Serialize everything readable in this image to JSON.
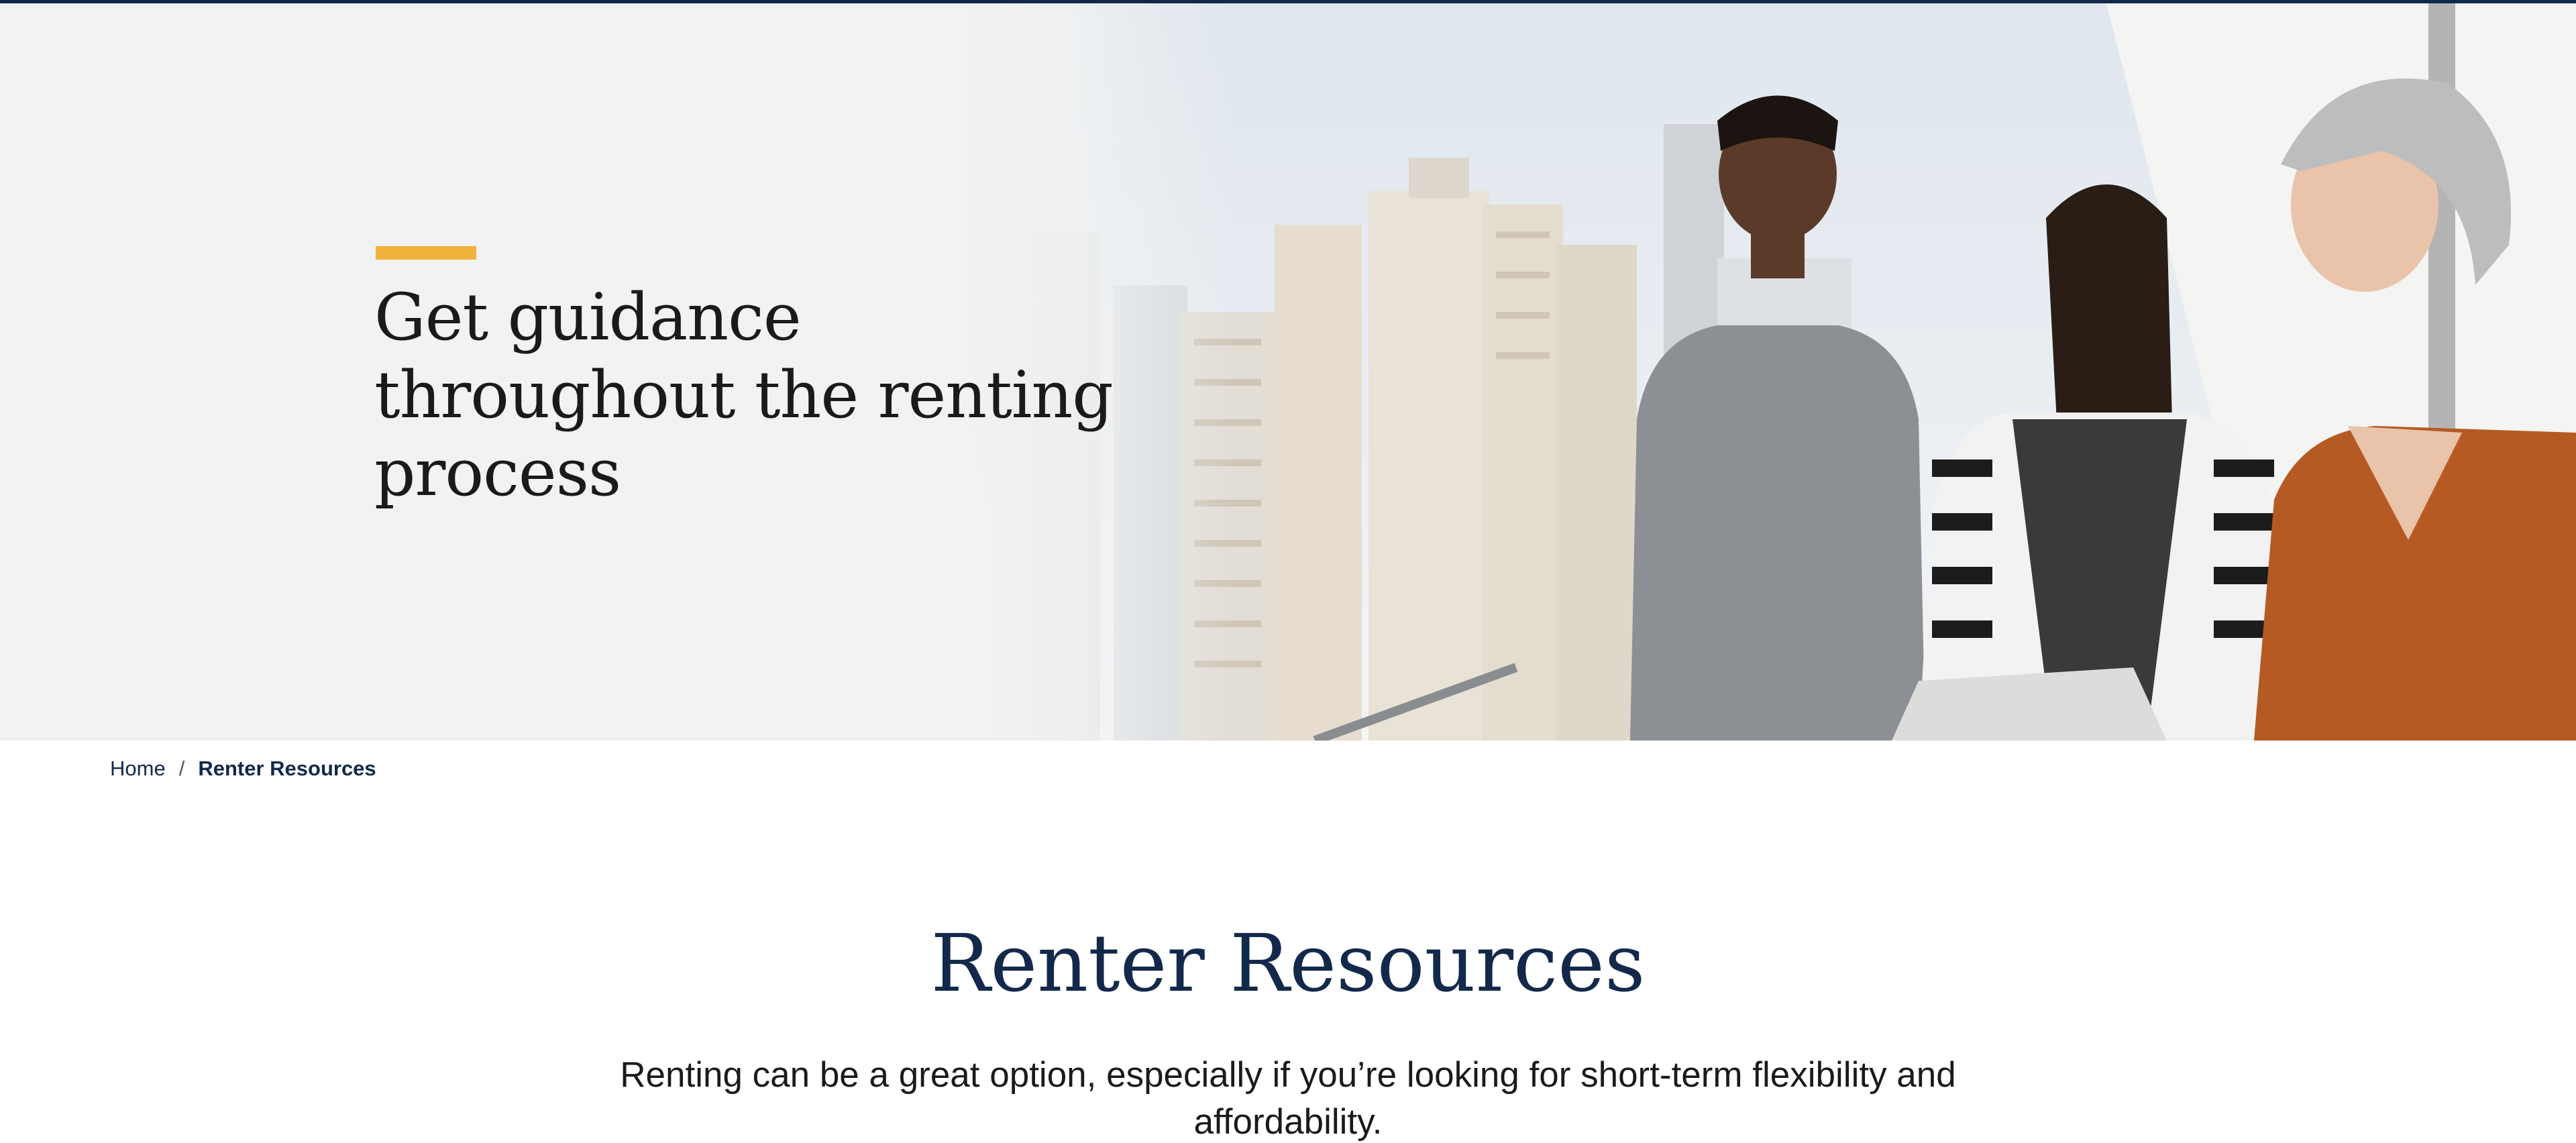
{
  "hero": {
    "title": "Get guidance throughout the renting process",
    "image": "three people on a balcony looking at a tablet with city buildings behind"
  },
  "breadcrumb": {
    "home": "Home",
    "separator": "/",
    "current": "Renter Resources"
  },
  "main": {
    "title": "Renter Resources",
    "intro": "Renting can be a great option, especially if you’re looking for short-term flexibility and affordability."
  },
  "colors": {
    "navy": "#13294b",
    "accent": "#f0b43c",
    "hero_bg": "#f1f2f2"
  }
}
